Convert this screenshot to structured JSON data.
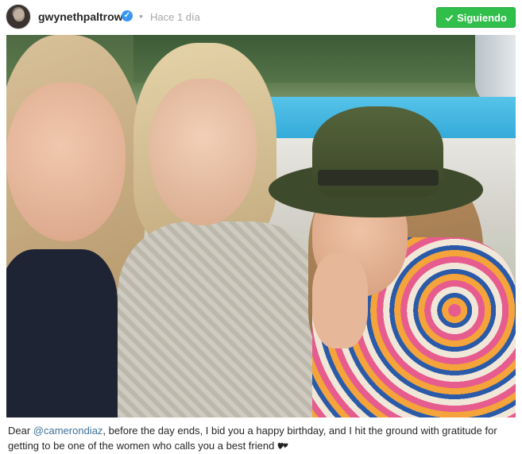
{
  "header": {
    "username": "gwynethpaltrow",
    "verified_icon": "verified-badge-icon",
    "separator": "•",
    "timestamp": "Hace 1 día",
    "follow_button": {
      "label": "Siguiendo",
      "icon": "check-icon",
      "color": "#2fbf4a"
    }
  },
  "post": {
    "image_alt": "Selfie of three women outdoors by a pool"
  },
  "caption": {
    "prefix": "Dear ",
    "mention": "@camerondiaz",
    "text": ", before the day ends, I bid you a happy birthday, and I hit the ground with gratitude for getting to be one of the women who calls you a best friend ",
    "emoji_icon": "two-hearts-icon"
  },
  "colors": {
    "link": "#3f729b",
    "meta": "#a5a7aa",
    "verified": "#3897f0"
  }
}
